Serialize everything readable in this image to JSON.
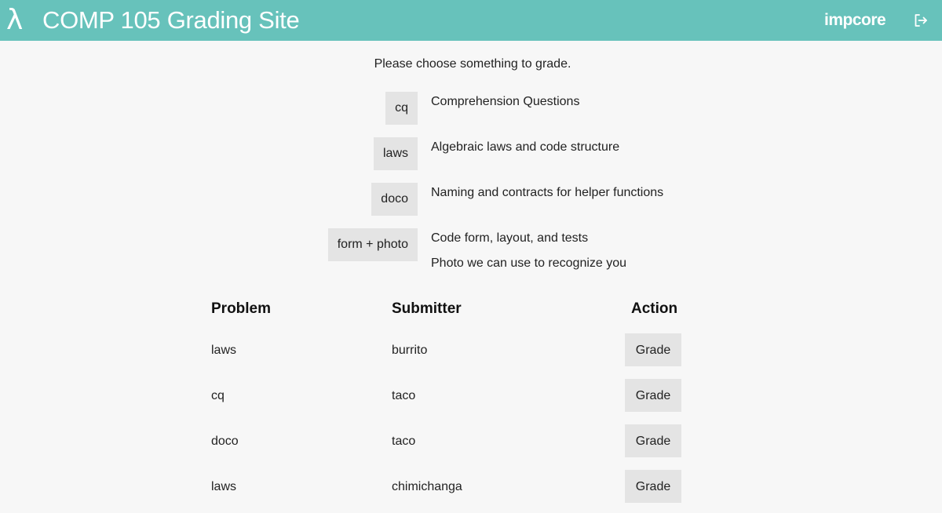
{
  "header": {
    "logo_glyph": "λ",
    "title": "COMP 105 Grading Site",
    "user": "impcore",
    "logout_icon": "logout-icon",
    "background_color": "#67c2bb"
  },
  "prompt": "Please choose something to grade.",
  "categories": [
    {
      "button": "cq",
      "descriptions": [
        "Comprehension Questions"
      ]
    },
    {
      "button": "laws",
      "descriptions": [
        "Algebraic laws and code structure"
      ]
    },
    {
      "button": "doco",
      "descriptions": [
        "Naming and contracts for helper functions"
      ]
    },
    {
      "button": "form + photo",
      "descriptions": [
        "Code form, layout, and tests",
        "Photo we can use to recognize you"
      ]
    }
  ],
  "table": {
    "headers": [
      "Problem",
      "Submitter",
      "Action"
    ],
    "rows": [
      {
        "problem": "laws",
        "submitter": "burrito",
        "action": "Grade"
      },
      {
        "problem": "cq",
        "submitter": "taco",
        "action": "Grade"
      },
      {
        "problem": "doco",
        "submitter": "taco",
        "action": "Grade"
      },
      {
        "problem": "laws",
        "submitter": "chimichanga",
        "action": "Grade"
      }
    ]
  }
}
